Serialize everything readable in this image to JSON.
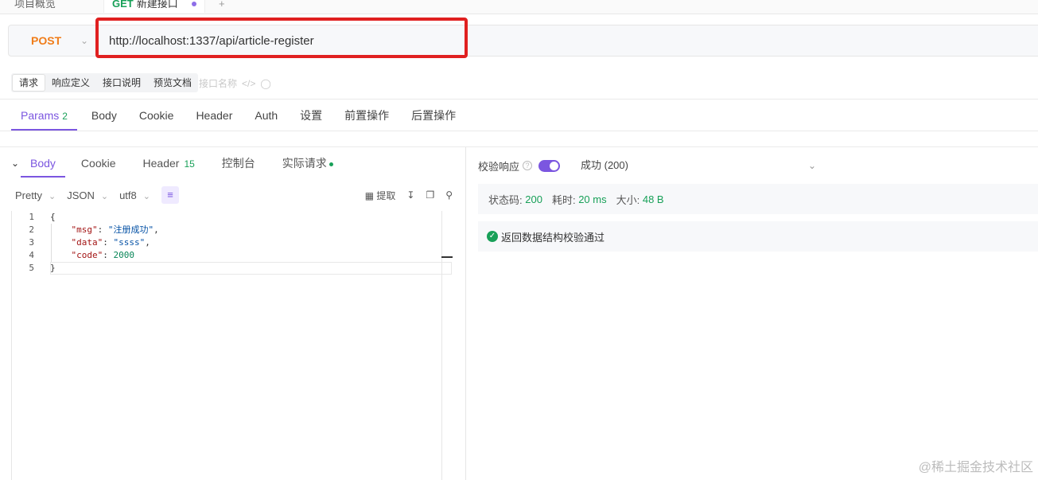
{
  "top_tabs": [
    {
      "label": "项目概览"
    },
    {
      "method": "GET",
      "label": "新建接口"
    },
    {
      "label": "+"
    }
  ],
  "request": {
    "method": "POST",
    "url": "http://localhost:1337/api/article-register"
  },
  "sub_tabs": [
    "请求",
    "响应定义",
    "接口说明",
    "预览文档"
  ],
  "sub_extra": "接口名称",
  "params_tabs": [
    {
      "label": "Params",
      "badge": "2"
    },
    {
      "label": "Body"
    },
    {
      "label": "Cookie"
    },
    {
      "label": "Header"
    },
    {
      "label": "Auth"
    },
    {
      "label": "设置"
    },
    {
      "label": "前置操作"
    },
    {
      "label": "后置操作"
    }
  ],
  "response_tabs": [
    {
      "label": "Body"
    },
    {
      "label": "Cookie"
    },
    {
      "label": "Header",
      "count": "15"
    },
    {
      "label": "控制台"
    },
    {
      "label": "实际请求"
    }
  ],
  "format_bar": {
    "pretty": "Pretty",
    "type": "JSON",
    "encoding": "utf8",
    "extract": "提取"
  },
  "code_lines": [
    {
      "n": "1",
      "text": "{"
    },
    {
      "n": "2",
      "key": "\"msg\"",
      "val": "\"注册成功\"",
      "tail": ","
    },
    {
      "n": "3",
      "key": "\"data\"",
      "val": "\"ssss\"",
      "tail": ","
    },
    {
      "n": "4",
      "key": "\"code\"",
      "num": "2000",
      "tail": ""
    },
    {
      "n": "5",
      "text": "}"
    }
  ],
  "validation": {
    "label": "校验响应",
    "enabled": true,
    "status_option": "成功 (200)",
    "result": "返回数据结构校验通过"
  },
  "meta": {
    "status_label": "状态码:",
    "status_value": "200",
    "time_label": "耗时:",
    "time_value": "20 ms",
    "size_label": "大小:",
    "size_value": "48 B"
  },
  "watermark": "@稀土掘金技术社区",
  "colors": {
    "accent": "#7b56e0",
    "success": "#18a058",
    "post_method": "#f07d1a",
    "highlight": "#e02020"
  }
}
